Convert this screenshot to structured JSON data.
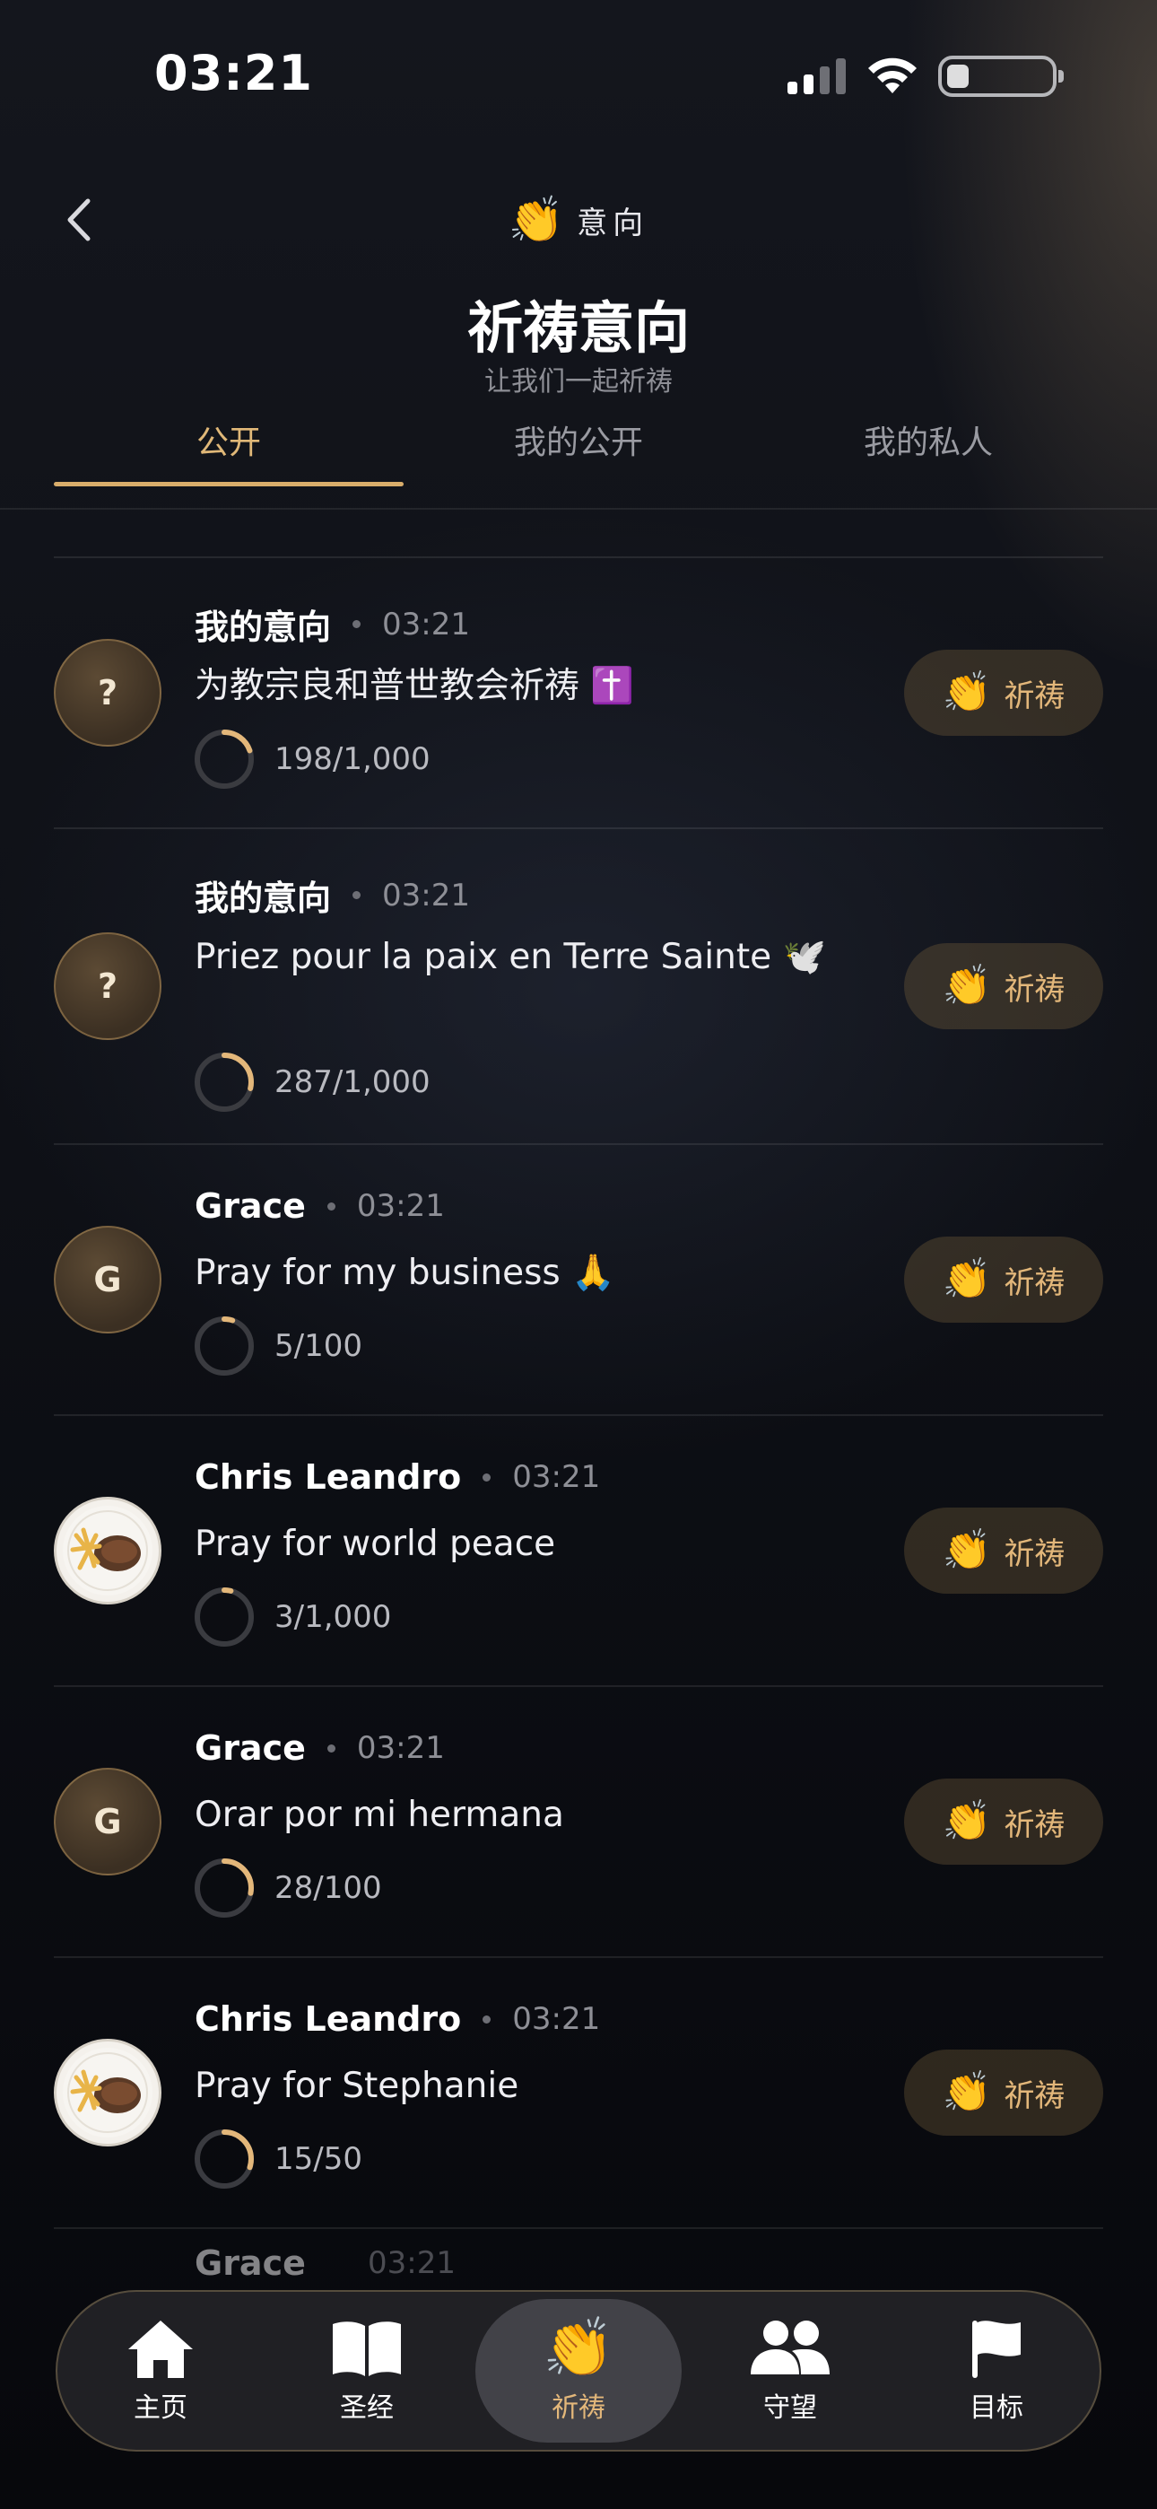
{
  "status_bar": {
    "time": "03:21"
  },
  "header": {
    "subtitle": "意向",
    "title": "祈祷意向",
    "caption": "让我们一起祈祷"
  },
  "tabs": [
    {
      "label": "公开",
      "active": true
    },
    {
      "label": "我的公开",
      "active": false
    },
    {
      "label": "我的私人",
      "active": false
    }
  ],
  "items": [
    {
      "name": "我的意向",
      "time": "03:21",
      "text": "为教宗良和普世教会祈祷 ✝️",
      "count": "198/1,000",
      "progress": 0.198,
      "avatar": "?",
      "button": "祈祷"
    },
    {
      "name": "我的意向",
      "time": "03:21",
      "text": "Priez pour la paix en Terre Sainte 🕊️",
      "count": "287/1,000",
      "progress": 0.287,
      "avatar": "?",
      "button": "祈祷"
    },
    {
      "name": "Grace",
      "time": "03:21",
      "text": "Pray for my business 🙏",
      "count": "5/100",
      "progress": 0.05,
      "avatar": "G",
      "button": "祈祷"
    },
    {
      "name": "Chris Leandro",
      "time": "03:21",
      "text": "Pray for world peace",
      "count": "3/1,000",
      "progress": 0.003,
      "avatar": "photo",
      "button": "祈祷"
    },
    {
      "name": "Grace",
      "time": "03:21",
      "text": "Orar por mi hermana",
      "count": "28/100",
      "progress": 0.28,
      "avatar": "G",
      "button": "祈祷"
    },
    {
      "name": "Chris Leandro",
      "time": "03:21",
      "text": "Pray for Stephanie",
      "count": "15/50",
      "progress": 0.3,
      "avatar": "photo",
      "button": "祈祷"
    }
  ],
  "peek_item": {
    "name": "Grace",
    "time": "03:21"
  },
  "nav": [
    {
      "label": "主页",
      "icon": "home-icon"
    },
    {
      "label": "圣经",
      "icon": "bible-icon"
    },
    {
      "label": "祈祷",
      "icon": "pray-hands-icon",
      "active": true
    },
    {
      "label": "守望",
      "icon": "people-icon"
    },
    {
      "label": "目标",
      "icon": "flag-icon"
    }
  ],
  "colors": {
    "accent": "#e3b77a",
    "progress_track": "#3a3b40"
  }
}
